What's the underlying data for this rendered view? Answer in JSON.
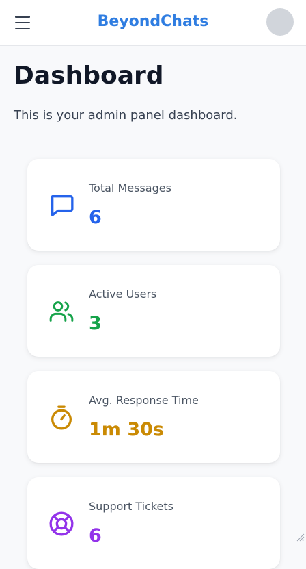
{
  "header": {
    "brand": "BeyondChats",
    "menu_icon": "hamburger-menu-icon",
    "avatar": "user-avatar",
    "brand_color": "#2f7de1"
  },
  "page": {
    "title": "Dashboard",
    "description": "This is your admin panel dashboard."
  },
  "stats": [
    {
      "label": "Total Messages",
      "value": "6",
      "icon": "chat-bubble-icon",
      "color": "#2563eb"
    },
    {
      "label": "Active Users",
      "value": "3",
      "icon": "users-icon",
      "color": "#16a34a"
    },
    {
      "label": "Avg. Response Time",
      "value": "1m 30s",
      "icon": "stopwatch-icon",
      "color": "#ca8a04"
    },
    {
      "label": "Support Tickets",
      "value": "6",
      "icon": "lifebuoy-icon",
      "color": "#9333ea"
    }
  ]
}
